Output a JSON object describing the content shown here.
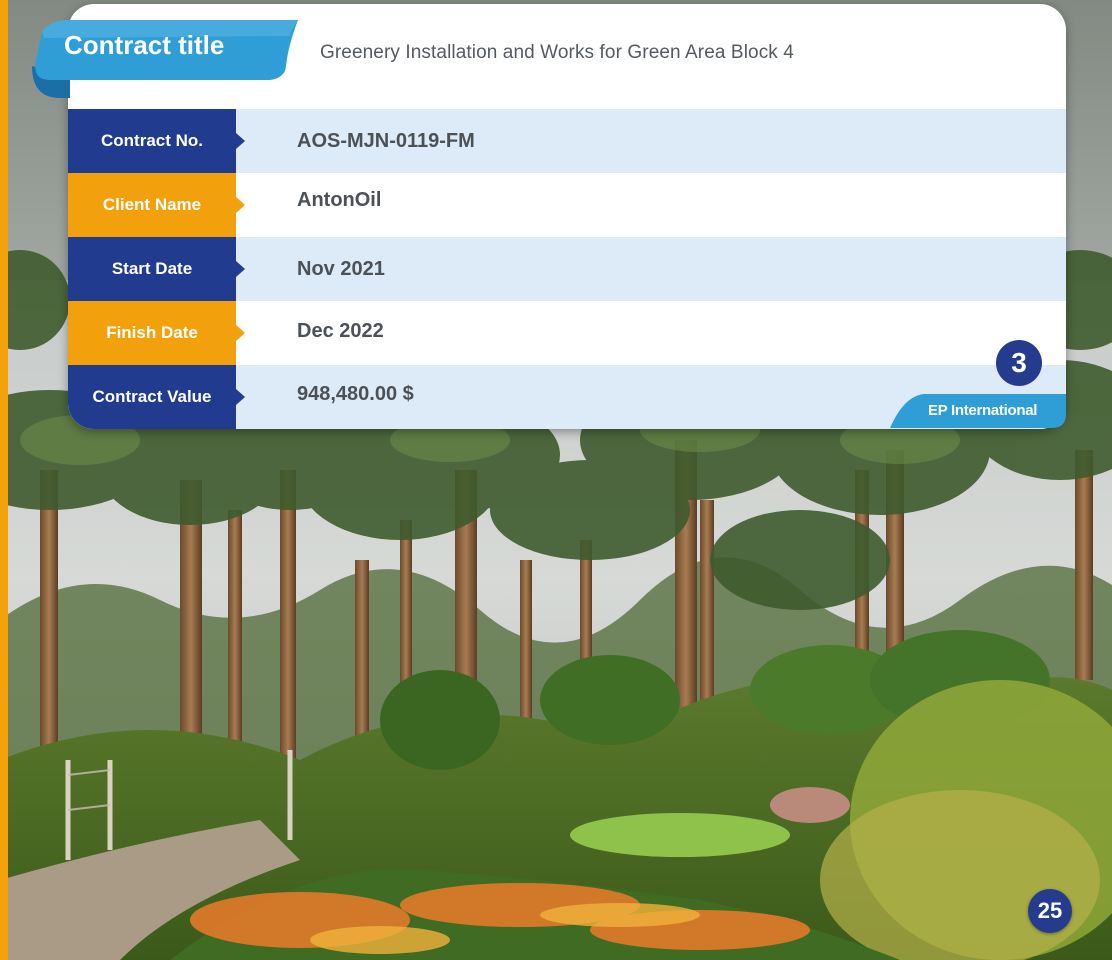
{
  "contract": {
    "heading": "Contract title",
    "title": "Greenery Installation and Works for Green Area Block 4"
  },
  "rows": [
    {
      "label": "Contract No.",
      "value": "AOS-MJN-0119-FM"
    },
    {
      "label": "Client Name",
      "value": "AntonOil"
    },
    {
      "label": "Start Date",
      "value": "Nov 2021"
    },
    {
      "label": "Finish Date",
      "value": "Dec 2022"
    },
    {
      "label": "Contract Value",
      "value": "948,480.00 $"
    }
  ],
  "project_number": "3",
  "brand": "EP International",
  "page_number": "25",
  "colors": {
    "navy": "#213b8f",
    "orange": "#f2a10d",
    "row_tint": "#dcebf7",
    "ribbon_blue": "#2f9ed6"
  },
  "background_image": "photo of date palm grove with flowering garden beds"
}
